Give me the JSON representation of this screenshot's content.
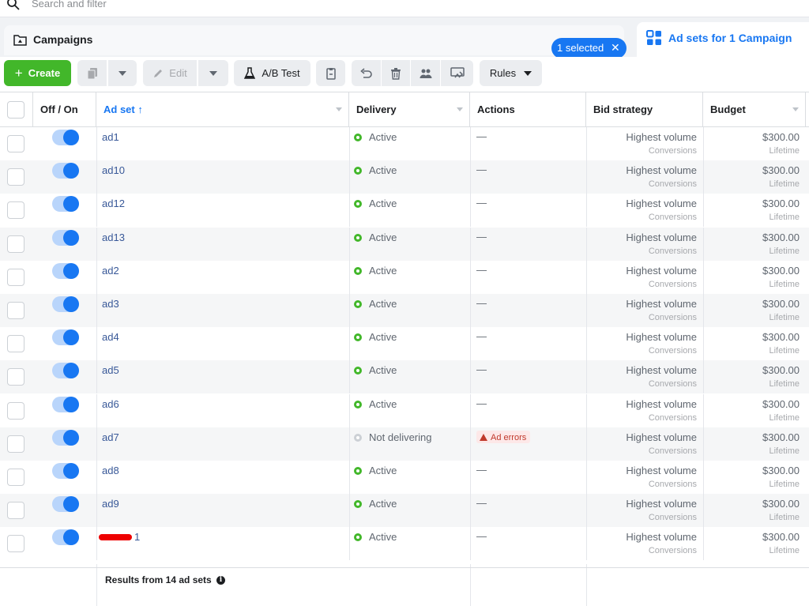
{
  "search": {
    "placeholder": "Search and filter"
  },
  "tabs": {
    "campaigns_label": "Campaigns",
    "selected_pill": "1 selected",
    "adsets_label": "Ad sets for 1 Campaign"
  },
  "toolbar": {
    "create_label": "Create",
    "edit_label": "Edit",
    "ab_test_label": "A/B Test",
    "rules_label": "Rules"
  },
  "columns": {
    "off_on": "Off / On",
    "ad_set": "Ad set",
    "delivery": "Delivery",
    "actions": "Actions",
    "bid_strategy": "Bid strategy",
    "budget": "Budget"
  },
  "rows": [
    {
      "name": "ad1",
      "delivery": "Active",
      "action": "—",
      "bid": "Highest volume",
      "bid_sub": "Conversions",
      "budget": "$300.00",
      "budget_sub": "Lifetime",
      "on": true
    },
    {
      "name": "ad10",
      "delivery": "Active",
      "action": "—",
      "bid": "Highest volume",
      "bid_sub": "Conversions",
      "budget": "$300.00",
      "budget_sub": "Lifetime",
      "on": true
    },
    {
      "name": "ad12",
      "delivery": "Active",
      "action": "—",
      "bid": "Highest volume",
      "bid_sub": "Conversions",
      "budget": "$300.00",
      "budget_sub": "Lifetime",
      "on": true
    },
    {
      "name": "ad13",
      "delivery": "Active",
      "action": "—",
      "bid": "Highest volume",
      "bid_sub": "Conversions",
      "budget": "$300.00",
      "budget_sub": "Lifetime",
      "on": true
    },
    {
      "name": "ad2",
      "delivery": "Active",
      "action": "—",
      "bid": "Highest volume",
      "bid_sub": "Conversions",
      "budget": "$300.00",
      "budget_sub": "Lifetime",
      "on": true
    },
    {
      "name": "ad3",
      "delivery": "Active",
      "action": "—",
      "bid": "Highest volume",
      "bid_sub": "Conversions",
      "budget": "$300.00",
      "budget_sub": "Lifetime",
      "on": true
    },
    {
      "name": "ad4",
      "delivery": "Active",
      "action": "—",
      "bid": "Highest volume",
      "bid_sub": "Conversions",
      "budget": "$300.00",
      "budget_sub": "Lifetime",
      "on": true
    },
    {
      "name": "ad5",
      "delivery": "Active",
      "action": "—",
      "bid": "Highest volume",
      "bid_sub": "Conversions",
      "budget": "$300.00",
      "budget_sub": "Lifetime",
      "on": true
    },
    {
      "name": "ad6",
      "delivery": "Active",
      "action": "—",
      "bid": "Highest volume",
      "bid_sub": "Conversions",
      "budget": "$300.00",
      "budget_sub": "Lifetime",
      "on": true
    },
    {
      "name": "ad7",
      "delivery": "Not delivering",
      "action": "Ad errors",
      "bid": "Highest volume",
      "bid_sub": "Conversions",
      "budget": "$300.00",
      "budget_sub": "Lifetime",
      "on": true,
      "error": true
    },
    {
      "name": "ad8",
      "delivery": "Active",
      "action": "—",
      "bid": "Highest volume",
      "bid_sub": "Conversions",
      "budget": "$300.00",
      "budget_sub": "Lifetime",
      "on": true
    },
    {
      "name": "ad9",
      "delivery": "Active",
      "action": "—",
      "bid": "Highest volume",
      "bid_sub": "Conversions",
      "budget": "$300.00",
      "budget_sub": "Lifetime",
      "on": true
    },
    {
      "name": "1",
      "delivery": "Active",
      "action": "—",
      "bid": "Highest volume",
      "bid_sub": "Conversions",
      "budget": "$300.00",
      "budget_sub": "Lifetime",
      "on": true,
      "redacted": true
    }
  ],
  "footer": {
    "results": "Results from 14 ad sets"
  },
  "colors": {
    "accent": "#1877f2",
    "create_green": "#42b72a",
    "error_red": "#c0392b"
  }
}
